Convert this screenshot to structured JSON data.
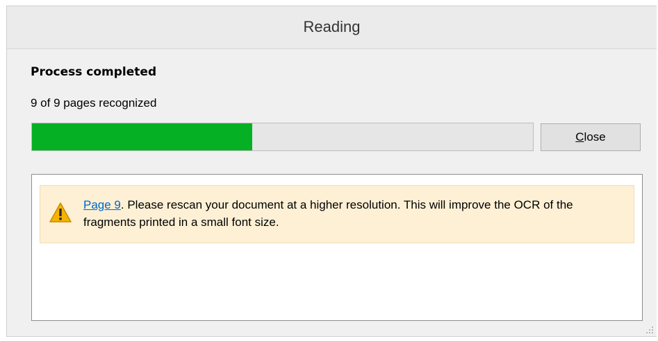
{
  "window": {
    "title": "Reading"
  },
  "status": {
    "heading": "Process completed",
    "detail": "9 of 9 pages recognized"
  },
  "progress": {
    "percent": 44,
    "fill_color": "#06b025"
  },
  "close_button": {
    "accelerator": "C",
    "rest": "lose"
  },
  "messages": [
    {
      "severity": "warning",
      "icon": "warning-triangle-icon",
      "link_text": "Page 9",
      "text": ". Please rescan your document at a higher resolution. This will improve the OCR of the fragments printed in a small font size."
    }
  ]
}
